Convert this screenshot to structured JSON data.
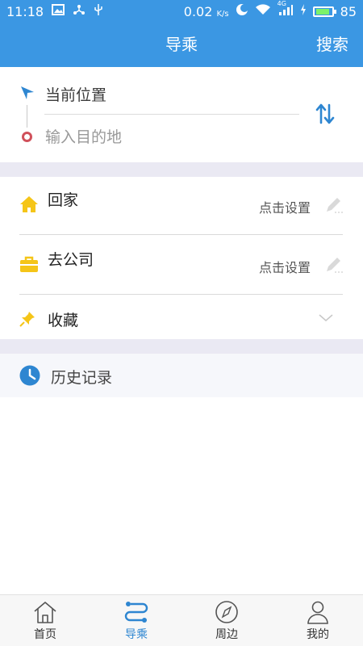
{
  "status_bar": {
    "time": "11:18",
    "speed": "0.02",
    "speed_unit": "K/s",
    "network": "4G",
    "battery": "85"
  },
  "nav": {
    "title": "导乘",
    "search_label": "搜索"
  },
  "route": {
    "start_label": "当前位置",
    "destination_placeholder": "输入目的地"
  },
  "shortcuts": {
    "home": {
      "label": "回家",
      "hint": "点击设置"
    },
    "company": {
      "label": "去公司",
      "hint": "点击设置"
    },
    "favorites": {
      "label": "收藏"
    }
  },
  "history": {
    "label": "历史记录"
  },
  "tabs": [
    {
      "label": "首页",
      "icon": "home-icon"
    },
    {
      "label": "导乘",
      "icon": "route-icon"
    },
    {
      "label": "周边",
      "icon": "compass-icon"
    },
    {
      "label": "我的",
      "icon": "user-icon"
    }
  ],
  "colors": {
    "primary": "#3b97e3",
    "accent_yellow": "#f5c518",
    "destination_red": "#d0505a",
    "separator_bg": "#eae9f3"
  }
}
